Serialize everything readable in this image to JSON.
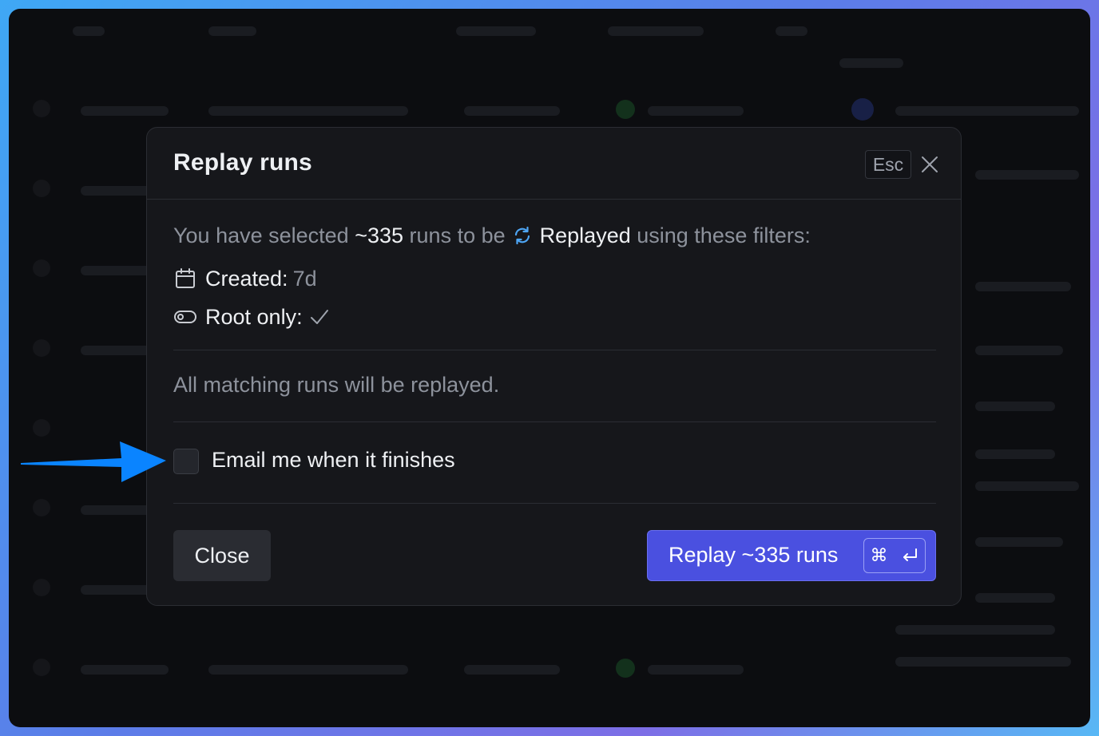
{
  "dialog": {
    "title": "Replay runs",
    "esc_label": "Esc",
    "summary": {
      "prefix": "You have selected",
      "count": "~335",
      "middle": "runs to be",
      "action": "Replayed",
      "suffix": "using these filters:"
    },
    "filters": [
      {
        "icon": "calendar-icon",
        "label": "Created:",
        "value": "7d"
      },
      {
        "icon": "toggle-icon",
        "label": "Root only:",
        "value_icon": "checkmark-icon"
      }
    ],
    "note": "All matching runs will be replayed.",
    "email_checkbox": {
      "label": "Email me when it finishes",
      "checked": false
    },
    "buttons": {
      "close_label": "Close",
      "replay_label": "Replay ~335 runs",
      "shortcut_symbol": "⌘"
    }
  },
  "colors": {
    "accent": "#4a50e0",
    "annotation_arrow": "#0a84ff",
    "replay_icon": "#4ea6f5"
  }
}
